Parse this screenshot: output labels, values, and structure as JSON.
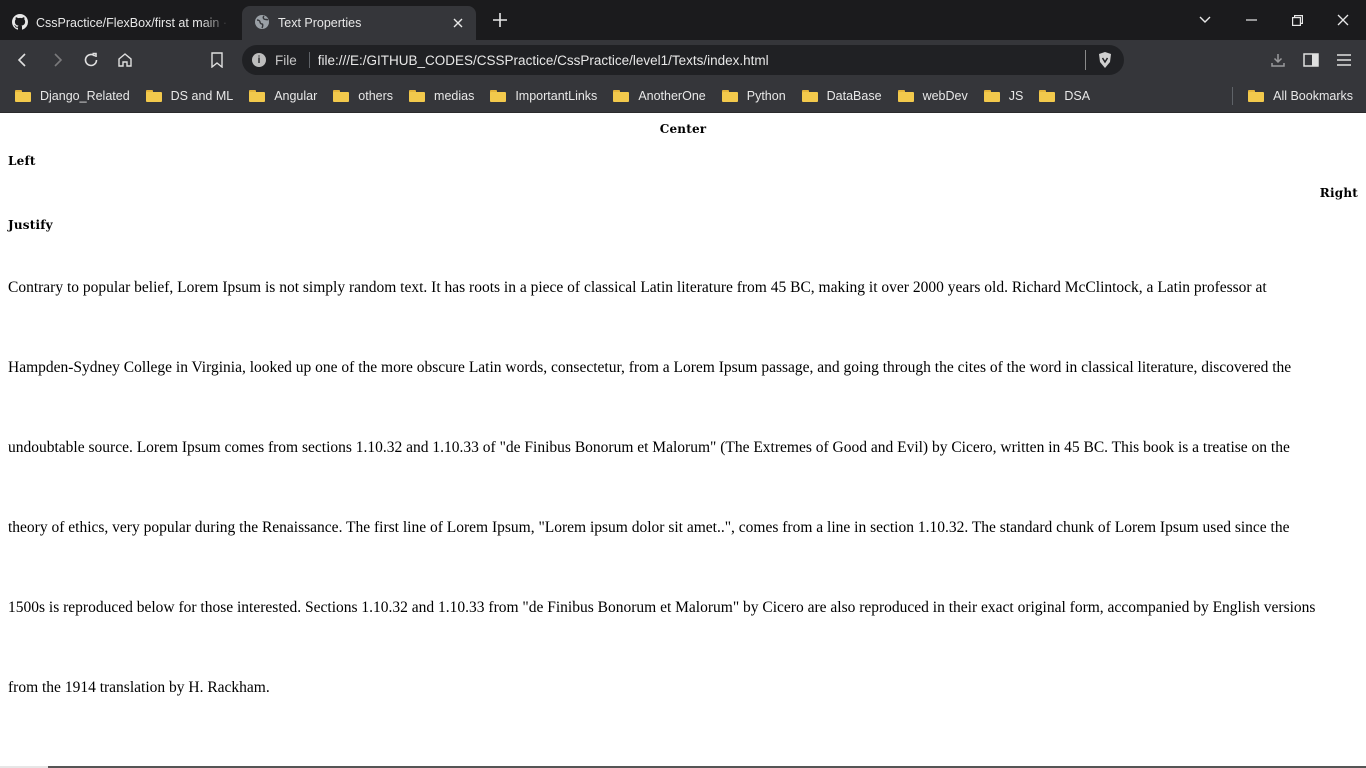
{
  "browser": {
    "tabs": [
      {
        "title": "CssPractice/FlexBox/first at main · Kr",
        "icon": "github-icon",
        "active": false
      },
      {
        "title": "Text Properties",
        "icon": "globe-icon",
        "active": true
      }
    ],
    "address": {
      "scheme_label": "File",
      "url": "file:///E:/GITHUB_CODES/CSSPractice/CssPractice/level1/Texts/index.html"
    },
    "bookmarks": [
      {
        "label": "Django_Related"
      },
      {
        "label": "DS and ML"
      },
      {
        "label": "Angular"
      },
      {
        "label": "others"
      },
      {
        "label": "medias"
      },
      {
        "label": "ImportantLinks"
      },
      {
        "label": "AnotherOne"
      },
      {
        "label": "Python"
      },
      {
        "label": "DataBase"
      },
      {
        "label": "webDev"
      },
      {
        "label": "JS"
      },
      {
        "label": "DSA"
      }
    ],
    "all_bookmarks_label": "All Bookmarks",
    "colors": {
      "tabbar": "#1b1b1d",
      "toolbar": "#35363a",
      "omnibox": "#202124",
      "folder": "#f2c94c"
    }
  },
  "page": {
    "headings": {
      "center": "Center",
      "left": "Left",
      "right": "Right",
      "justify": "Justify"
    },
    "paragraph_lines": [
      "Contrary to popular belief, Lorem Ipsum is not simply random text. It has roots in a piece of classical Latin literature from 45 BC, making it over 2000 years old. Richard McClintock, a Latin professor at",
      "Hampden-Sydney College in Virginia, looked up one of the more obscure Latin words, consectetur, from a Lorem Ipsum passage, and going through the cites of the word in classical literature, discovered the",
      "undoubtable source. Lorem Ipsum comes from sections 1.10.32 and 1.10.33 of \"de Finibus Bonorum et Malorum\" (The Extremes of Good and Evil) by Cicero, written in 45 BC. This book is a treatise on the",
      "theory of ethics, very popular during the Renaissance. The first line of Lorem Ipsum, \"Lorem ipsum dolor sit amet..\", comes from a line in section 1.10.32. The standard chunk of Lorem Ipsum used since the",
      "1500s is reproduced below for those interested. Sections 1.10.32 and 1.10.33 from \"de Finibus Bonorum et Malorum\" by Cicero are also reproduced in their exact original form, accompanied by English versions",
      "from the 1914 translation by H. Rackham."
    ]
  }
}
